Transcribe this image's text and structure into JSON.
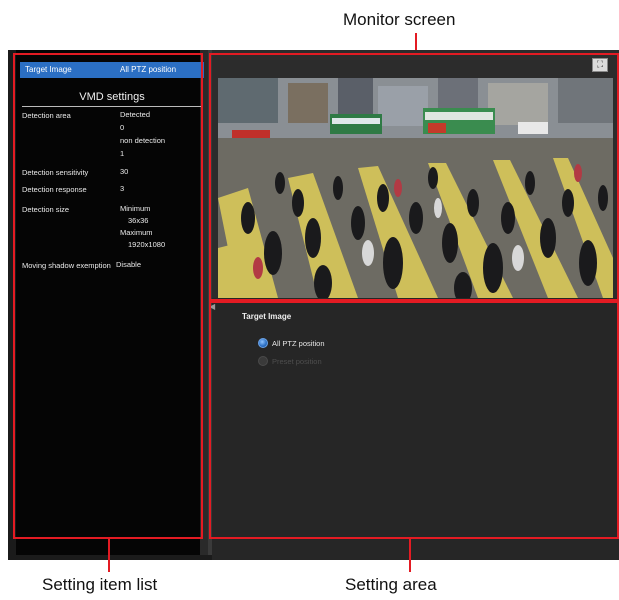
{
  "captions": {
    "monitor_screen": "Monitor screen",
    "setting_item_list": "Setting item list",
    "setting_area": "Setting area"
  },
  "colors": {
    "accent": "#2b6fc4",
    "callout": "#e31b23",
    "panel": "#050505",
    "background": "#262626"
  },
  "setting_list": {
    "header_key": "Target Image",
    "header_value": "All PTZ position",
    "section_title": "VMD settings",
    "rows": [
      {
        "label": "Detection area",
        "values": [
          "Detected",
          "0",
          "non detection",
          "1"
        ]
      },
      {
        "label": "Detection sensitivity",
        "values": [
          "30"
        ]
      },
      {
        "label": "Detection response",
        "values": [
          "3"
        ]
      },
      {
        "label": "Detection size",
        "values": [
          "Minimum",
          "36x36",
          "Maximum",
          "1920x1080"
        ]
      },
      {
        "label": "Moving shadow exemption",
        "values": [
          "Disable"
        ]
      }
    ]
  },
  "monitor": {
    "fullscreen_icon": "fullscreen-icon",
    "image": "crowd-crosswalk-photo"
  },
  "setting_area": {
    "title": "Target Image",
    "options": [
      {
        "label": "All PTZ position",
        "selected": true,
        "enabled": true
      },
      {
        "label": "Preset position",
        "selected": false,
        "enabled": false
      }
    ]
  }
}
